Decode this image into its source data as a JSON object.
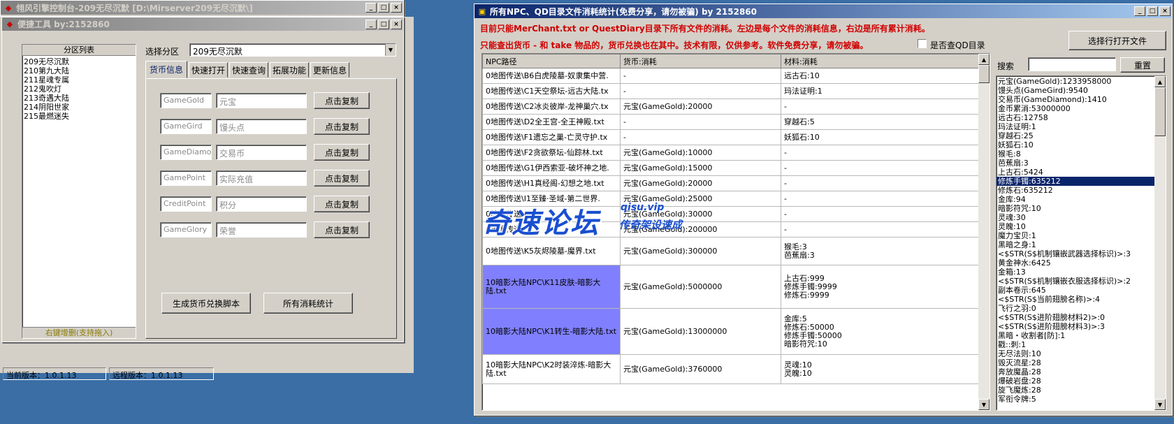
{
  "back_window": {
    "title": "翎风引擎控制台-209无尽沉默 [D:\\Mirserver209无尽沉默\\]"
  },
  "tool_window": {
    "title": "便捷工具   by:2152860",
    "zone_list_header": "分区列表",
    "zones": [
      "209无尽沉默",
      "210第九大陆",
      "211星魂专属",
      "212鬼吹灯",
      "213奇遇大陆",
      "214阴阳世家",
      "215最燃迷失"
    ],
    "zone_list_footer": "右键增删(支持拖入)",
    "select_zone_label": "选择分区",
    "selected_zone": "209无尽沉默",
    "tabs": [
      "货币信息",
      "快速打开",
      "快速查询",
      "拓展功能",
      "更新信息"
    ],
    "currency_rows": [
      {
        "code": "GameGold",
        "name": "元宝",
        "button": "点击复制"
      },
      {
        "code": "GameGird",
        "name": "馒头点",
        "button": "点击复制"
      },
      {
        "code": "GameDiamond",
        "name": "交易币",
        "button": "点击复制"
      },
      {
        "code": "GamePoint",
        "name": "实际充值",
        "button": "点击复制"
      },
      {
        "code": "CreditPoint",
        "name": "积分",
        "button": "点击复制"
      },
      {
        "code": "GameGlory",
        "name": "荣誉",
        "button": "点击复制"
      }
    ],
    "gen_script_button": "生成货币兑换脚本",
    "all_stats_button": "所有消耗统计",
    "current_version": "当前版本：1.0.1.13",
    "remote_version": "远程版本：1.0.1.13"
  },
  "stats_window": {
    "title": "所有NPC、QD目录文件消耗统计(免费分享，请勿被骗)   by 2152860",
    "info_line1": "目前只能MerChant.txt or QuestDiary目录下所有文件的消耗。左边是每个文件的消耗信息，右边是所有累计消耗。",
    "info_line2": "只能查出货币 - 和 take 物品的，货币兑换也在其中。技术有限，仅供参考。软件免费分享，请勿被骗。",
    "qd_checkbox_label": "是否查QD目录",
    "open_file_button": "选择行打开文件",
    "search_label": "搜索",
    "reset_button": "重置",
    "columns": [
      "NPC路径",
      "货币:消耗",
      "材料:消耗"
    ],
    "rows": [
      {
        "path": "0地图传送\\B6白虎陵墓-奴隶集中营.",
        "currency": "-",
        "material": "远古石:10"
      },
      {
        "path": "0地图传送\\C1天空祭坛-远古大陆.tx",
        "currency": "-",
        "material": "玛法证明:1"
      },
      {
        "path": "0地图传送\\C2冰炎彼岸-龙神巢穴.tx",
        "currency": "元宝(GameGold):20000",
        "material": "-"
      },
      {
        "path": "0地图传送\\D2全王宫-全王神殿.txt",
        "currency": "-",
        "material": "穿越石:5"
      },
      {
        "path": "0地图传送\\F1遗忘之巢-亡灵守护.tx",
        "currency": "-",
        "material": "妖狐石:10"
      },
      {
        "path": "0地图传送\\F2贪欲祭坛-仙踪林.txt",
        "currency": "元宝(GameGold):10000",
        "material": "-"
      },
      {
        "path": "0地图传送\\G1伊西索亚-破坏神之地.",
        "currency": "元宝(GameGold):15000",
        "material": "-"
      },
      {
        "path": "0地图传送\\H1真经阁-幻想之地.txt",
        "currency": "元宝(GameGold):20000",
        "material": "-"
      },
      {
        "path": "0地图传送\\I1至臻·圣域-第二世界.",
        "currency": "元宝(GameGold):25000",
        "material": "-"
      },
      {
        "path": "0地图传送\\I2...",
        "currency": "元宝(GameGold):30000",
        "material": "-"
      },
      {
        "path": "0地图传送\\J1...",
        "currency": "元宝(GameGold):200000",
        "material": "-"
      },
      {
        "path": "0地图传送\\K5灰烬陵墓-魔界.txt",
        "currency": "元宝(GameGold):300000",
        "material": "猴毛:3\n芭蕉扇:3"
      },
      {
        "path": "10暗影大陆NPC\\K11皮肤-暗影大陆.txt",
        "currency": "元宝(GameGold):5000000",
        "material": "上古石:999\n修炼手镯:9999\n修炼石:9999"
      },
      {
        "path": "10暗影大陆NPC\\K1转生-暗影大陆.txt",
        "currency": "元宝(GameGold):13000000",
        "material": "金库:5\n修炼石:50000\n修炼手镯:50000\n暗影符咒:10"
      },
      {
        "path": "10暗影大陆NPC\\K2时装淬炼-暗影大陆.txt",
        "currency": "元宝(GameGold):3760000",
        "material": "灵魂:10\n灵魄:10"
      }
    ],
    "totals": [
      "元宝(GameGold):1233958000",
      "馒头点(GameGird):9540",
      "交易币(GameDiamond):1410",
      "金币累消:53000000",
      "远古石:12758",
      "玛法证明:1",
      "穿越石:25",
      "妖狐石:10",
      "猴毛:8",
      "芭蕉扇:3",
      "上古石:5424",
      "修炼手镯:635212",
      "修炼石:635212",
      "金库:94",
      "暗影符咒:10",
      "灵魂:30",
      "灵魄:10",
      "魔力宝贝:1",
      "黑暗之身:1",
      "<$STR(S$机制镶嵌武器选择标识)>:3",
      "黄金神水:6425",
      "金箱:13",
      "<$STR(S$机制镶嵌衣服选择标识)>:2",
      "副本卷示:645",
      "<$STR(S$当前翅膀名称)>:4",
      "飞行之羽:0",
      "<$STR(S$进阶翅膀材料2)>:0",
      "<$STR(S$进阶翅膀材料3)>:3",
      "黑暗・收割者[防]:1",
      "戳::刺:1",
      "无尽法则:10",
      "毁灭流星:28",
      "奔放魔晶:28",
      "爆破岩盘:28",
      "旋飞魔炼:28",
      "军衔令牌:5"
    ],
    "selected_total_index": 11
  },
  "watermark": {
    "text": "奇速论坛",
    "sub": "qisu.vip",
    "tag": "传奇架设速成"
  }
}
